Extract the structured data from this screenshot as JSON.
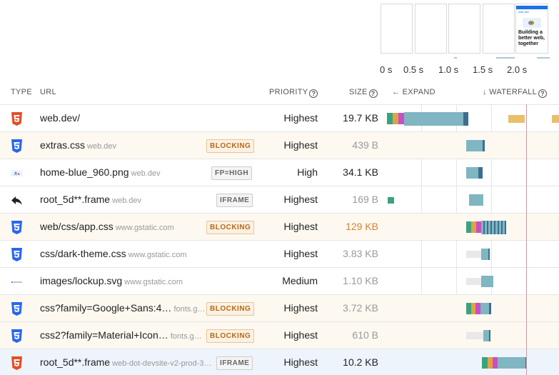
{
  "filmstrip": {
    "ticks": [
      "0 s",
      "0.5 s",
      "1.0 s",
      "1.5 s",
      "2.0 s"
    ],
    "last_frame_logo": "web.dev",
    "last_frame_text": "Building a better web, together"
  },
  "header": {
    "type": "TYPE",
    "url": "URL",
    "priority": "PRIORITY",
    "size": "SIZE",
    "expand": "← EXPAND",
    "waterfall": "↓ WATERFALL",
    "help": "?"
  },
  "rows": [
    {
      "name": "web.dev/",
      "domain": "",
      "badge": "",
      "priority": "Highest",
      "size": "19.7 KB",
      "icon": "html-icon"
    },
    {
      "name": "extras.css",
      "domain": "web.dev",
      "badge": "BLOCKING",
      "priority": "Highest",
      "size": "439 B",
      "icon": "css-icon"
    },
    {
      "name": "home-blue_960.png",
      "domain": "web.dev",
      "badge": "FP=HIGH",
      "priority": "High",
      "size": "34.1 KB",
      "icon": "image-icon"
    },
    {
      "name": "root_5d**.frame",
      "domain": "web.dev",
      "badge": "IFRAME",
      "priority": "Highest",
      "size": "169 B",
      "icon": "redirect-icon"
    },
    {
      "name": "web/css/app.css",
      "domain": "www.gstatic.com",
      "badge": "BLOCKING",
      "priority": "Highest",
      "size": "129 KB",
      "icon": "css-icon"
    },
    {
      "name": "css/dark-theme.css",
      "domain": "www.gstatic.com",
      "badge": "",
      "priority": "Highest",
      "size": "3.83 KB",
      "icon": "css-icon"
    },
    {
      "name": "images/lockup.svg",
      "domain": "www.gstatic.com",
      "badge": "",
      "priority": "Medium",
      "size": "1.10 KB",
      "icon": "svg-icon"
    },
    {
      "name": "css?family=Google+Sans:4…",
      "domain": "fonts.g…",
      "badge": "BLOCKING",
      "priority": "Highest",
      "size": "3.72 KB",
      "icon": "css-icon"
    },
    {
      "name": "css2?family=Material+Icon…",
      "domain": "fonts.g…",
      "badge": "BLOCKING",
      "priority": "Highest",
      "size": "610 B",
      "icon": "css-icon"
    },
    {
      "name": "root_5d**.frame",
      "domain": "web-dot-devsite-v2-prod-3…",
      "badge": "IFRAME",
      "priority": "Highest",
      "size": "10.2 KB",
      "icon": "html-icon"
    }
  ],
  "colors": {
    "html": "#e44d26",
    "css": "#2965f1",
    "bar": "#7fb6c2",
    "bar_dark": "#3e6e8e",
    "wait": "#e8e8e8",
    "dns": "#3aa37c",
    "connect": "#e0a245",
    "ssl": "#c94fc4",
    "blocking_orange": "#e8c06a"
  }
}
